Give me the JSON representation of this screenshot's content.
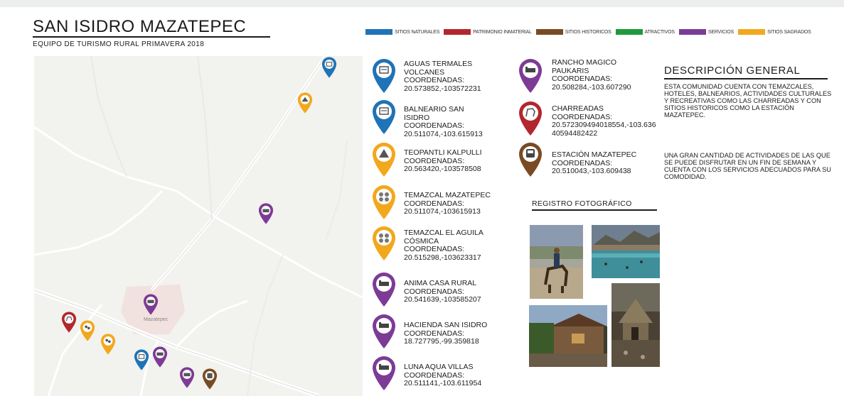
{
  "header": {
    "title": "SAN ISIDRO MAZATEPEC",
    "subtitle": "EQUIPO DE TURISMO RURAL PRIMAVERA 2018"
  },
  "legend": [
    {
      "label": "SITIOS NATURALES",
      "color": "#1f73b7"
    },
    {
      "label": "PATRIMONIO INMATERIAL",
      "color": "#b3262d"
    },
    {
      "label": "SITIOS HISTORICOS",
      "color": "#7a4a23"
    },
    {
      "label": "ATRACTIVOS",
      "color": "#1e9a3a"
    },
    {
      "label": "SERVICIOS",
      "color": "#7d3b96"
    },
    {
      "label": "SITIOS SAGRADOS",
      "color": "#f2a81d"
    }
  ],
  "map": {
    "town_label": "Mazatepec"
  },
  "pois": [
    {
      "name": "AGUAS TERMALES VOLCANES",
      "label": "COORDENADAS:",
      "coords": "20.573852,-103572231",
      "color": "#1f73b7",
      "icon": "pool-icon"
    },
    {
      "name": "BALNEARIO SAN ISIDRO",
      "label": "COORDENADAS:",
      "coords": "20.511074,-103.615913",
      "color": "#1f73b7",
      "icon": "pool-icon"
    },
    {
      "name": "TEOPANTLI KALPULLI",
      "label": "COORDENADAS:",
      "coords": "20.563420,-103578508",
      "color": "#f2a81d",
      "icon": "temple-icon"
    },
    {
      "name": "TEMAZCAL MAZATEPEC",
      "label": "COORDENADAS:",
      "coords": "20.511074,-103615913",
      "color": "#f2a81d",
      "icon": "temazcal-icon"
    },
    {
      "name": "TEMAZCAL EL AGUILA CÓSMICA",
      "label": "COORDENADAS:",
      "coords": "20.515298,-103623317",
      "color": "#f2a81d",
      "icon": "temazcal-icon"
    },
    {
      "name": "ANIMA CASA RURAL",
      "label": "COORDENADAS:",
      "coords": "20.541639,-103585207",
      "color": "#7d3b96",
      "icon": "bed-icon"
    },
    {
      "name": "HACIENDA SAN ISIDRO",
      "label": "COORDENADAS:",
      "coords": "18.727795,-99.359818",
      "color": "#7d3b96",
      "icon": "bed-icon"
    },
    {
      "name": "LUNA AQUA VILLAS",
      "label": "COORDENADAS:",
      "coords": "20.511141,-103.611954",
      "color": "#7d3b96",
      "icon": "bed-icon"
    },
    {
      "name": "RANCHO MAGICO PAUKARIS",
      "label": "COORDENADAS:",
      "coords": "20.508284,-103.607290",
      "color": "#7d3b96",
      "icon": "bed-icon"
    },
    {
      "name": "CHARREADAS",
      "label": "COORDENADAS:",
      "coords": "20.572309494018554,-103.63640594482422",
      "color": "#b3262d",
      "icon": "horse-icon"
    },
    {
      "name": "ESTACIÓN MAZATEPEC",
      "label": "COORDENADAS:",
      "coords": "20.510043,-103.609438",
      "color": "#7a4a23",
      "icon": "train-icon"
    }
  ],
  "description": {
    "title": "DESCRIPCIÓN GENERAL",
    "p1": "ESTA COMUNIDAD CUENTA CON TEMAZCALES, HOTELES, BALNEARIOS, ACTIVIDADES CULTURALES Y RECREATIVAS COMO LAS CHARREADAS Y CON SITIOS HISTORICOS COMO LA ESTACIÓN MAZATEPEC.",
    "p2": "UNA GRAN CANTIDAD DE ACTIVIDADES DE LAS QUE SE PUEDE DISFRUTAR EN UN FIN DE SEMANA Y CUENTA CON LOS SERVICIOS ADECUADOS PARA SU COMODIDAD."
  },
  "gallery": {
    "title": "REGISTRO FOTOGRÁFICO"
  }
}
